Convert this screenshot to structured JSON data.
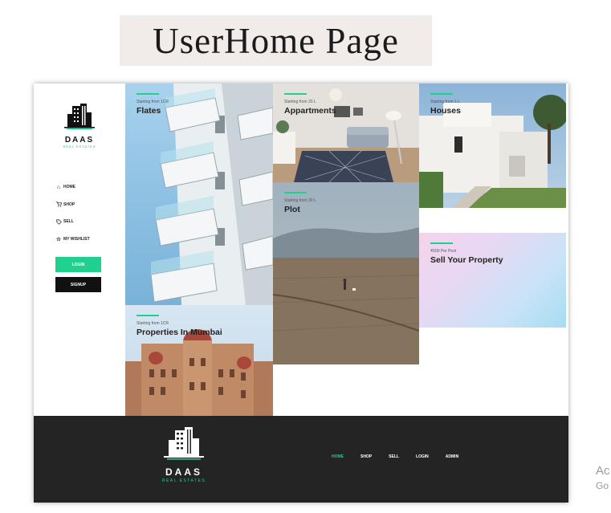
{
  "slide_title": "UserHome Page",
  "brand": {
    "name": "DAAS",
    "tagline": "REAL ESTATES"
  },
  "sidebar": {
    "items": [
      {
        "label": "HOME",
        "icon": "home-icon"
      },
      {
        "label": "SHOP",
        "icon": "cart-icon"
      },
      {
        "label": "SELL",
        "icon": "tag-icon"
      },
      {
        "label": "MY WISHLIST",
        "icon": "star-icon"
      }
    ],
    "login_label": "LOGIN",
    "signup_label": "SIGNUP"
  },
  "tiles": {
    "flates": {
      "subtitle": "Starting from 1CR",
      "title": "Flates"
    },
    "appartments": {
      "subtitle": "Starting from 20 L",
      "title": "Appartments"
    },
    "houses": {
      "subtitle": "Starting from 1 L",
      "title": "Houses"
    },
    "plot": {
      "subtitle": "Starting from 30 L",
      "title": "Plot"
    },
    "sell": {
      "subtitle": "₹500 Per Post",
      "title": "Sell Your Property"
    },
    "mumbai": {
      "subtitle": "Starting from 1CR",
      "title": "Properties In Mumbai"
    }
  },
  "footer": {
    "nav": [
      "HOME",
      "SHOP",
      "SELL",
      "LOGIN",
      "ADMIN"
    ],
    "active": "HOME"
  },
  "watermark": {
    "line1": "Ac",
    "line2": "Go"
  },
  "colors": {
    "accent": "#1fd08f",
    "footer_bg": "#242424",
    "signup_bg": "#111111"
  }
}
